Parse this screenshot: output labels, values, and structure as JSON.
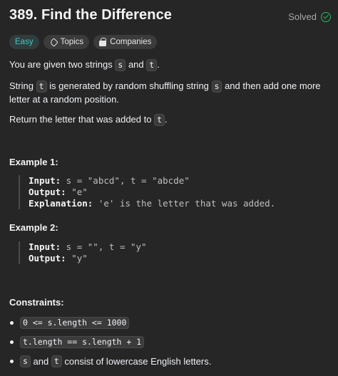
{
  "problem": {
    "title": "389. Find the Difference",
    "status": "Solved",
    "tags": {
      "difficulty": "Easy",
      "topics": "Topics",
      "companies": "Companies"
    }
  },
  "description": {
    "p1": {
      "before": "You are given two strings ",
      "s": "s",
      "mid": " and ",
      "t": "t",
      "after": "."
    },
    "p2": {
      "before": "String ",
      "t": "t",
      "mid": " is generated by random shuffling string ",
      "s": "s",
      "after": " and then add one more letter at a random position."
    },
    "p3": {
      "before": "Return the letter that was added to ",
      "t": "t",
      "after": "."
    }
  },
  "examples": [
    {
      "heading": "Example 1:",
      "input_label": "Input:",
      "input": " s = \"abcd\", t = \"abcde\"",
      "output_label": "Output:",
      "output": " \"e\"",
      "explanation_label": "Explanation:",
      "explanation": " 'e' is the letter that was added."
    },
    {
      "heading": "Example 2:",
      "input_label": "Input:",
      "input": " s = \"\", t = \"y\"",
      "output_label": "Output:",
      "output": " \"y\""
    }
  ],
  "constraints": {
    "heading": "Constraints:",
    "c1": "0 <= s.length <= 1000",
    "c2": "t.length == s.length + 1",
    "c3_s": "s",
    "c3_mid": " and ",
    "c3_t": "t",
    "c3_after": " consist of lowercase English letters."
  },
  "colors": {
    "easy": "#46c6c2",
    "solved_check": "#2cbb5d",
    "background": "#262626"
  },
  "icons": {
    "solved": "check-circle-icon",
    "topics": "tag-icon",
    "companies": "lock-icon"
  }
}
